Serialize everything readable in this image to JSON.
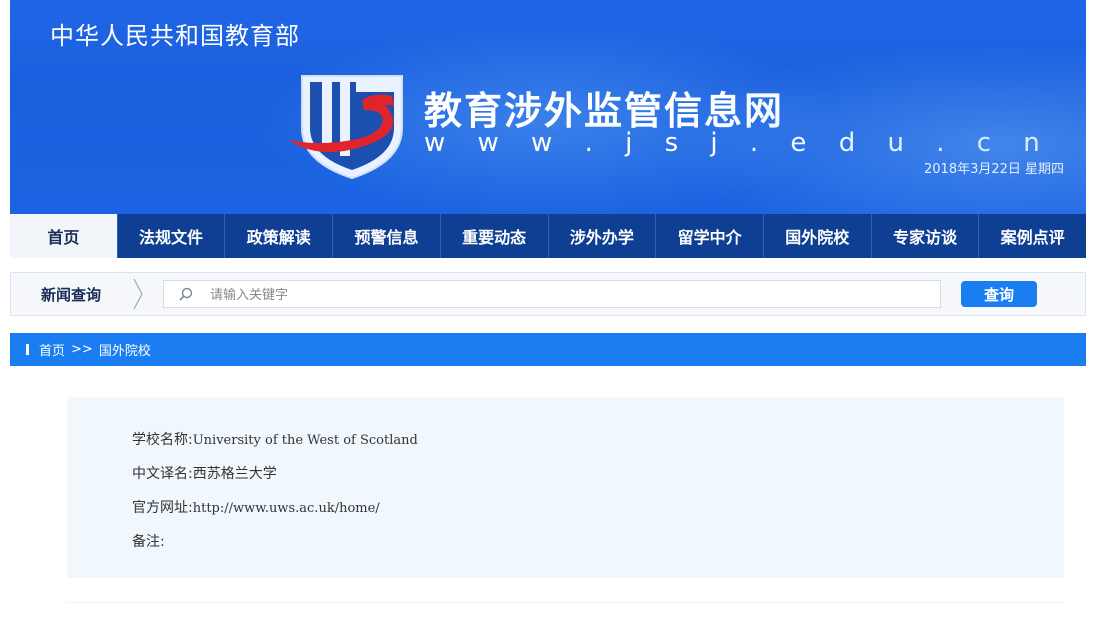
{
  "header": {
    "ministry": "中华人民共和国教育部",
    "site_title": "教育涉外监管信息网",
    "site_url": "w w w . j s j . e d u . c n",
    "date": "2018年3月22日 星期四"
  },
  "nav": {
    "items": [
      "首页",
      "法规文件",
      "政策解读",
      "预警信息",
      "重要动态",
      "涉外办学",
      "留学中介",
      "国外院校",
      "专家访谈",
      "案例点评"
    ],
    "active_index": 0
  },
  "search": {
    "label": "新闻查询",
    "placeholder": "请输入关键字",
    "button_label": "查询"
  },
  "breadcrumb": {
    "items": [
      "首页",
      "国外院校"
    ],
    "separator": ">>"
  },
  "school": {
    "name_label": "学校名称:",
    "name_value": "University of the West of Scotland",
    "cn_label": "中文译名:",
    "cn_value": "西苏格兰大学",
    "site_label": "官方网址:",
    "site_value": "http://www.uws.ac.uk/home/",
    "note_label": "备注:",
    "note_value": ""
  },
  "colors": {
    "banner_blue": "#1b63e2",
    "nav_dark": "#0e3f93",
    "accent_blue": "#1a7ef0",
    "logo_red": "#e0242b",
    "content_bg": "#f0f7fd"
  }
}
